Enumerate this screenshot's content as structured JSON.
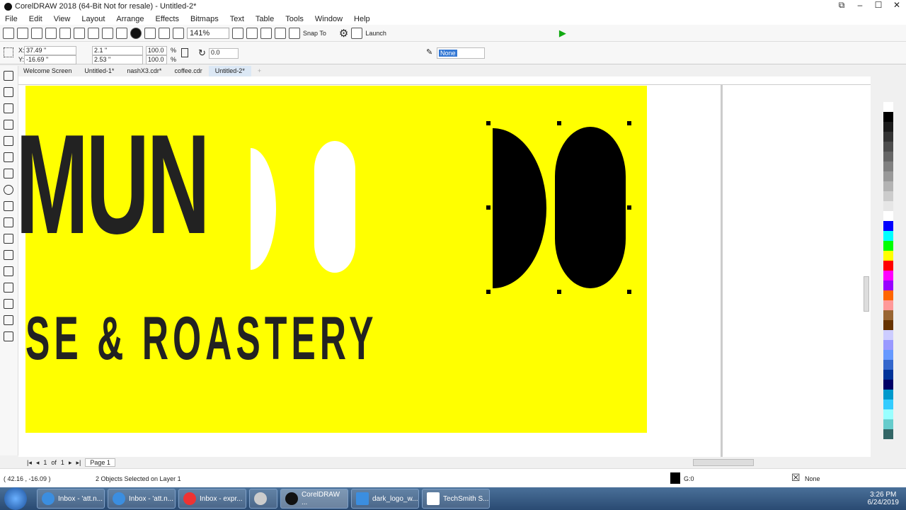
{
  "window": {
    "title": "CorelDRAW 2018 (64-Bit Not for resale) - Untitled-2*"
  },
  "menu": [
    "File",
    "Edit",
    "View",
    "Layout",
    "Arrange",
    "Effects",
    "Bitmaps",
    "Text",
    "Table",
    "Tools",
    "Window",
    "Help"
  ],
  "toolbar": {
    "zoom": "141%",
    "snap_to": "Snap To",
    "launch": "Launch"
  },
  "property_bar": {
    "x": "37.49 \"",
    "y": "-16.69 \"",
    "width": "2.1 \"",
    "height": "2.53 \"",
    "scale_x": "100.0",
    "scale_y": "100.0",
    "pct": "%",
    "rotation": "0.0",
    "outline": "None"
  },
  "doc_tabs": [
    "Welcome Screen",
    "Untitled-1*",
    "nashX3.cdr*",
    "coffee.cdr",
    "Untitled-2*"
  ],
  "artwork": {
    "line1": "MUN",
    "line2": "SE & ROASTERY"
  },
  "pager": {
    "current": "1",
    "of": "of",
    "total": "1",
    "page_tab": "Page 1"
  },
  "status": {
    "coords": "( 42.16 , -16.09 )",
    "selection": "2 Objects Selected on Layer 1",
    "fill": "G:0",
    "outline": "None"
  },
  "taskbar": {
    "items": [
      "Inbox - 'att.n...",
      "Inbox - 'att.n...",
      "Inbox - expr...",
      "",
      "CorelDRAW ...",
      "dark_logo_w...",
      "TechSmith S..."
    ],
    "time": "3:26 PM",
    "date": "6/24/2019"
  },
  "palette": [
    "#ffffff",
    "#000000",
    "#1a1a1a",
    "#333333",
    "#4d4d4d",
    "#666666",
    "#808080",
    "#999999",
    "#b3b3b3",
    "#cccccc",
    "#e6e6e6",
    "#ffffff",
    "#0000ff",
    "#00ffff",
    "#00ff00",
    "#ffff00",
    "#ff0000",
    "#ff00ff",
    "#9900ff",
    "#ff6600",
    "#ff9999",
    "#996633",
    "#663300",
    "#ccccff",
    "#9999ff",
    "#6699ff",
    "#3366cc",
    "#003399",
    "#000066",
    "#0099cc",
    "#33ccff",
    "#99ffff",
    "#66cccc",
    "#336666"
  ]
}
